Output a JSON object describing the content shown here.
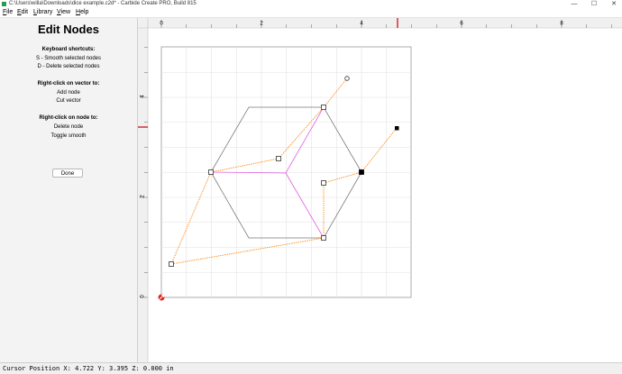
{
  "window": {
    "title": "C:\\Users\\willa\\Downloads\\dice example.c2d* - Carbide Create PRO, Build 815",
    "controls": {
      "minimize": "—",
      "maximize": "☐",
      "close": "✕"
    }
  },
  "menu": {
    "items": [
      {
        "label": "File",
        "accel": "F",
        "rest": "ile"
      },
      {
        "label": "Edit",
        "accel": "E",
        "rest": "dit"
      },
      {
        "label": "Library",
        "accel": "L",
        "rest": "ibrary"
      },
      {
        "label": "View",
        "accel": "V",
        "rest": "iew"
      },
      {
        "label": "Help",
        "accel": "H",
        "rest": "elp"
      }
    ]
  },
  "panel": {
    "title": "Edit Nodes",
    "shortcuts_heading": "Keyboard shortcuts:",
    "shortcut_smooth": "S - Smooth selected nodes",
    "shortcut_delete": "D - Delete selected nodes",
    "vector_heading": "Right-click on vector to:",
    "vector_add": "Add node",
    "vector_cut": "Cut vector",
    "node_heading": "Right-click on node to:",
    "node_delete": "Delete node",
    "node_toggle": "Toggle smooth",
    "done_label": "Done"
  },
  "rulers": {
    "top_labels": [
      "0",
      "2",
      "4",
      "6",
      "8"
    ],
    "left_labels": [
      "4",
      "2",
      "0"
    ]
  },
  "status": {
    "text": "Cursor Position X: 4.722 Y: 3.395 Z: 0.000 in"
  },
  "colors": {
    "hexagon": "#7a7a7a",
    "handles": "#ff8c1a",
    "inner_lines": "#e060e0",
    "grid": "#e2e2e2",
    "cursor_marker": "#cc0000",
    "origin_marker": "#e02020"
  }
}
